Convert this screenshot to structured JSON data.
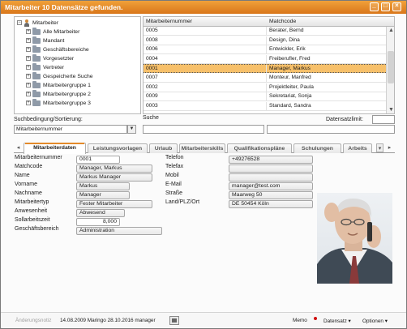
{
  "window": {
    "title": "Mitarbeiter 10 Datensätze gefunden."
  },
  "tree": {
    "root": "Mitarbeiter",
    "items": [
      "Alle Mitarbeiter",
      "Mandant",
      "Geschäftsbereiche",
      "Vorgesetzter",
      "Vertreter",
      "Gespeicherte Suche",
      "Mitarbeitergruppe 1",
      "Mitarbeitergruppe 2",
      "Mitarbeitergruppe 3"
    ]
  },
  "grid": {
    "columns": [
      "Mitarbeiternummer",
      "Matchcode"
    ],
    "rows": [
      {
        "nr": "0005",
        "match": "Berater, Bernd"
      },
      {
        "nr": "0008",
        "match": "Design, Dina"
      },
      {
        "nr": "0006",
        "match": "Entwickler, Erik"
      },
      {
        "nr": "0004",
        "match": "Freiberufler, Fred"
      },
      {
        "nr": "0001",
        "match": "Manager, Markus"
      },
      {
        "nr": "0007",
        "match": "Monteur, Manfred"
      },
      {
        "nr": "0002",
        "match": "Projektleiter, Paula"
      },
      {
        "nr": "0009",
        "match": "Sekretariat, Sonja"
      },
      {
        "nr": "0003",
        "match": "Standard, Sandra"
      }
    ],
    "selected_index": 4
  },
  "search": {
    "condition_label": "Suchbedingung/Sortierung:",
    "condition_value": "Mitarbeiternummer",
    "search_label": "Suche",
    "limit_label": "Datensatzlimit:",
    "search_value": "",
    "limit_value": ""
  },
  "tabs": [
    "Mitarbeiterdaten",
    "Leistungsvorlagen",
    "Urlaub",
    "Mitarbeiterskills",
    "Qualifikationspläne",
    "Schulungen",
    "Arbeits"
  ],
  "active_tab": 0,
  "form_left": [
    {
      "label": "Mitarbeiternummer",
      "value": "0001"
    },
    {
      "label": "Matchcode",
      "value": "Manager, Markus"
    },
    {
      "label": "Name",
      "value": "Markus Manager"
    },
    {
      "label": "Vorname",
      "value": "Markus"
    },
    {
      "label": "Nachname",
      "value": "Manager"
    },
    {
      "label": "Mitarbeitertyp",
      "value": "Fester Mitarbeiter"
    },
    {
      "label": "Anwesenheit",
      "value": "Abwesend"
    },
    {
      "label": "Sollarbeitszeit",
      "value": "8,000"
    },
    {
      "label": "Geschäftsbereich",
      "value": "Administration"
    }
  ],
  "form_right": [
    {
      "label": "Telefon",
      "value": "+49276528"
    },
    {
      "label": "Telefax",
      "value": ""
    },
    {
      "label": "Mobil",
      "value": ""
    },
    {
      "label": "E-Mail",
      "value": "manager@test.com"
    },
    {
      "label": "Straße",
      "value": "Maarweg 50"
    },
    {
      "label": "Land/PLZ/Ort",
      "value": "DE 50454 Köln"
    }
  ],
  "status": {
    "changes_label": "Änderungsnotiz",
    "changes_text": "14.08.2009 Maringo 28.10.2016 manager",
    "memo": "Memo",
    "record": "Datensatz",
    "options": "Optionen"
  },
  "colors": {
    "accent": "#e38a2a",
    "selection": "#f7c06a",
    "memo_dot": "#d01010"
  }
}
